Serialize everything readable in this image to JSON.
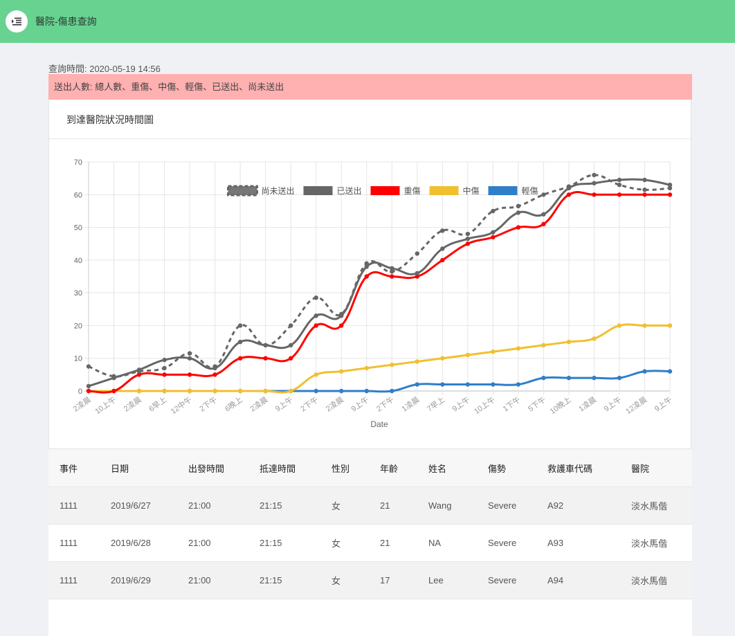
{
  "app": {
    "title": "醫院-傷患查詢"
  },
  "query": {
    "label": "查詢時間: 2020-05-19 14:56"
  },
  "alert": {
    "text": "送出人數: 總人數、重傷、中傷、輕傷、已送出、尚未送出"
  },
  "chart_card": {
    "title": "到達醫院狀況時間圖"
  },
  "colors": {
    "topbar": "#68d391",
    "alert": "#ffb0b0",
    "pending": "#666666",
    "sent": "#666666",
    "severe": "#ff0000",
    "moderate": "#f0c02f",
    "minor": "#2f7fc8"
  },
  "icons": {
    "menu": "menu-icon"
  },
  "chart_data": {
    "type": "line",
    "title": "",
    "xlabel": "Date",
    "ylabel": "",
    "ylim": [
      0,
      70
    ],
    "yticks": [
      0,
      10,
      20,
      30,
      40,
      50,
      60,
      70
    ],
    "grid": true,
    "legend_position": "top",
    "categories": [
      "2凌晨",
      "10上午",
      "2凌晨",
      "6早上",
      "12中午",
      "2下午",
      "6晚上",
      "2凌晨",
      "9上午",
      "2下午",
      "2凌晨",
      "9上午",
      "2下午",
      "1凌晨",
      "7早上",
      "9上午",
      "10上午",
      "1下午",
      "5下午",
      "10晚上",
      "1凌晨",
      "9上午",
      "12凌晨",
      "9上午"
    ],
    "series": [
      {
        "name": "尚未送出",
        "color": "#666666",
        "dashed": true,
        "values": [
          7.5,
          4.5,
          6,
          7,
          11.5,
          7.5,
          20,
          14,
          20,
          28.5,
          23.5,
          39,
          36.5,
          42,
          49,
          48,
          55,
          56.5,
          60,
          62.5,
          66,
          63,
          61.5,
          62
        ]
      },
      {
        "name": "已送出",
        "color": "#666666",
        "dashed": false,
        "values": [
          1.5,
          4,
          6.5,
          9.5,
          10,
          7,
          15,
          14,
          14,
          23,
          23,
          38,
          37.5,
          36,
          43.5,
          46.5,
          48.5,
          54.5,
          54,
          62,
          63.5,
          64.5,
          64.5,
          63
        ]
      },
      {
        "name": "重傷",
        "color": "#ff0000",
        "dashed": false,
        "values": [
          0,
          0,
          5,
          5,
          5,
          5,
          10,
          10,
          10,
          20,
          20,
          35,
          35,
          35,
          40,
          45,
          47,
          50,
          51,
          60,
          60,
          60,
          60,
          60
        ]
      },
      {
        "name": "中傷",
        "color": "#f0c02f",
        "dashed": false,
        "values": [
          0,
          0,
          0,
          0,
          0,
          0,
          0,
          0,
          0,
          5,
          6,
          7,
          8,
          9,
          10,
          11,
          12,
          13,
          14,
          15,
          16,
          20,
          20,
          20
        ]
      },
      {
        "name": "輕傷",
        "color": "#2f7fc8",
        "dashed": false,
        "values": [
          0,
          0,
          0,
          0,
          0,
          0,
          0,
          0,
          0,
          0,
          0,
          0,
          0,
          2,
          2,
          2,
          2,
          2,
          4,
          4,
          4,
          4,
          6,
          6
        ]
      }
    ]
  },
  "table": {
    "columns": [
      "事件",
      "日期",
      "出發時間",
      "抵達時間",
      "性別",
      "年齡",
      "姓名",
      "傷勢",
      "救護車代碼",
      "醫院"
    ],
    "rows": [
      [
        "1111",
        "2019/6/27",
        "21:00",
        "21:15",
        "女",
        "21",
        "Wang",
        "Severe",
        "A92",
        "淡水馬偕"
      ],
      [
        "1111",
        "2019/6/28",
        "21:00",
        "21:15",
        "女",
        "21",
        "NA",
        "Severe",
        "A93",
        "淡水馬偕"
      ],
      [
        "1111",
        "2019/6/29",
        "21:00",
        "21:15",
        "女",
        "17",
        "Lee",
        "Severe",
        "A94",
        "淡水馬偕"
      ]
    ]
  }
}
